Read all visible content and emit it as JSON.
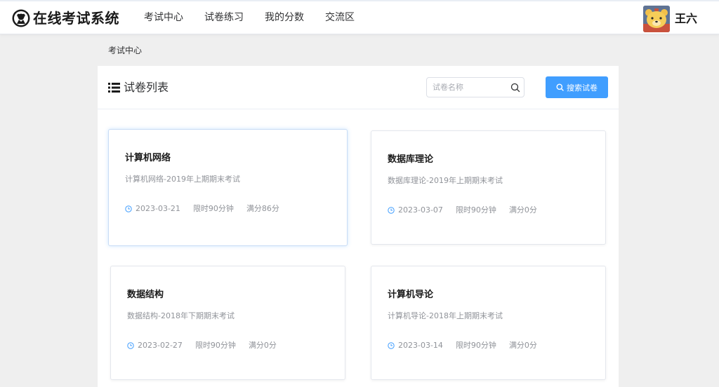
{
  "app": {
    "title": "在线考试系统"
  },
  "nav": {
    "items": [
      "考试中心",
      "试卷练习",
      "我的分数",
      "交流区"
    ]
  },
  "user": {
    "name": "王六"
  },
  "breadcrumb": "考试中心",
  "panel": {
    "title": "试卷列表",
    "search_placeholder": "试卷名称",
    "search_value": "",
    "search_button": "搜索试卷"
  },
  "papers": [
    {
      "title": "计算机网络",
      "desc": "计算机网络-2019年上期期末考试",
      "date": "2023-03-21",
      "limit": "限时90分钟",
      "score": "满分86分"
    },
    {
      "title": "数据库理论",
      "desc": "数据库理论-2019年上期期末考试",
      "date": "2023-03-07",
      "limit": "限时90分钟",
      "score": "满分0分"
    },
    {
      "title": "数据结构",
      "desc": "数据结构-2018年下期期末考试",
      "date": "2023-02-27",
      "limit": "限时90分钟",
      "score": "满分0分"
    },
    {
      "title": "计算机导论",
      "desc": "计算机导论-2018年上期期末考试",
      "date": "2023-03-14",
      "limit": "限时90分钟",
      "score": "满分0分"
    }
  ],
  "colors": {
    "primary": "#409eff",
    "page_bg": "#efefef",
    "text_muted": "#909399"
  },
  "icons": {
    "logo": "sheep-emblem-icon",
    "list": "list-icon",
    "search": "search-icon",
    "clock": "clock-icon"
  }
}
